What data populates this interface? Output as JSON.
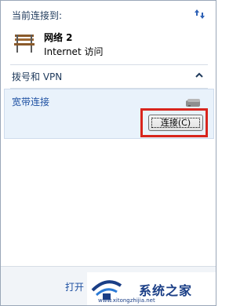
{
  "header": {
    "title": "当前连接到:",
    "refresh_icon": "refresh-icon"
  },
  "current_network": {
    "name": "网络  2",
    "access": "Internet 访问",
    "icon": "bench-network-icon"
  },
  "dialup_section": {
    "label": "拨号和 VPN",
    "collapse_icon": "chevron-up-icon"
  },
  "connection": {
    "name": "宽带连接",
    "icon": "modem-icon",
    "connect_label": "连接(C)"
  },
  "footer": {
    "link_text": "打开"
  },
  "watermark": {
    "text": "系统之家",
    "url": "www.xitongzhijia.net"
  },
  "colors": {
    "highlight_box": "#d8251d",
    "selected_bg": "#e9f2fb",
    "link": "#1e50a2"
  }
}
